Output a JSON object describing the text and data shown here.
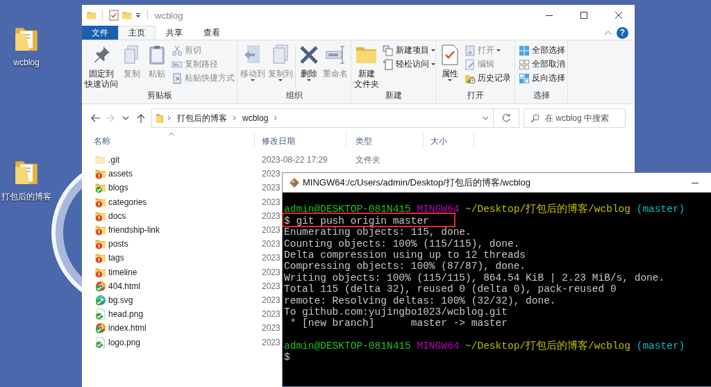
{
  "desktop_icons": [
    {
      "label": "wcblog"
    },
    {
      "label": "打包后的博客"
    }
  ],
  "explorer": {
    "title": "wcblog",
    "ribbon_tabs": [
      {
        "label": "文件",
        "kind": "file",
        "selected": false
      },
      {
        "label": "主页",
        "kind": "tab",
        "selected": true
      },
      {
        "label": "共享",
        "kind": "tab",
        "selected": false
      },
      {
        "label": "查看",
        "kind": "tab",
        "selected": false
      }
    ],
    "help_label": "?",
    "ribbon_groups": [
      {
        "label": "剪贴板",
        "items": [
          {
            "label_lines": [
              "固定到",
              "快速访问"
            ],
            "kind": "large",
            "disabled": false,
            "dropdown": false
          },
          {
            "label": "复制",
            "kind": "large",
            "disabled": true,
            "dropdown": false
          },
          {
            "label": "粘贴",
            "kind": "large",
            "disabled": true,
            "dropdown": false
          },
          {
            "label": "剪切",
            "kind": "small",
            "disabled": true,
            "dropdown": false
          },
          {
            "label": "复制路径",
            "kind": "small",
            "disabled": true,
            "dropdown": false
          },
          {
            "label": "粘贴快捷方式",
            "kind": "small",
            "disabled": true,
            "dropdown": false
          }
        ]
      },
      {
        "label": "组织",
        "items": [
          {
            "label": "移动到",
            "kind": "large",
            "disabled": true,
            "dropdown": true
          },
          {
            "label": "复制到",
            "kind": "large",
            "disabled": true,
            "dropdown": true
          },
          {
            "label": "删除",
            "kind": "large",
            "disabled": false,
            "dropdown": true
          },
          {
            "label": "重命名",
            "kind": "large",
            "disabled": true,
            "dropdown": false
          }
        ]
      },
      {
        "label": "新建",
        "items": [
          {
            "label_lines": [
              "新建",
              "文件夹"
            ],
            "kind": "large",
            "disabled": false,
            "dropdown": false
          },
          {
            "label": "新建项目",
            "kind": "small",
            "disabled": false,
            "dropdown": true
          },
          {
            "label": "轻松访问",
            "kind": "small",
            "disabled": false,
            "dropdown": true
          }
        ]
      },
      {
        "label": "打开",
        "items": [
          {
            "label": "属性",
            "kind": "large",
            "disabled": false,
            "dropdown": true
          },
          {
            "label": "打开",
            "kind": "small",
            "disabled": true,
            "dropdown": true
          },
          {
            "label": "编辑",
            "kind": "small",
            "disabled": true,
            "dropdown": false
          },
          {
            "label": "历史记录",
            "kind": "small",
            "disabled": false,
            "dropdown": false
          }
        ]
      },
      {
        "label": "选择",
        "items": [
          {
            "label": "全部选择",
            "kind": "small",
            "disabled": false,
            "dropdown": false
          },
          {
            "label": "全部取消",
            "kind": "small",
            "disabled": false,
            "dropdown": false
          },
          {
            "label": "反向选择",
            "kind": "small",
            "disabled": false,
            "dropdown": false
          }
        ]
      }
    ],
    "nav_buttons": [
      {
        "kind": "back",
        "disabled": false
      },
      {
        "kind": "forward",
        "disabled": true
      },
      {
        "kind": "recent",
        "disabled": false
      },
      {
        "kind": "up",
        "disabled": false
      }
    ],
    "breadcrumb": [
      "打包后的博客",
      "wcblog"
    ],
    "search": {
      "placeholder": "在 wcblog 中搜索"
    },
    "columns": [
      {
        "label": "名称",
        "sorted": true
      },
      {
        "label": "修改日期",
        "sorted": false
      },
      {
        "label": "类型",
        "sorted": false
      },
      {
        "label": "大小",
        "sorted": false
      }
    ],
    "rows": [
      {
        "name": ".git",
        "kind": "folder",
        "hidden": true,
        "modified": false,
        "date": "2023-08-22 17:29",
        "type": "文件夹"
      },
      {
        "name": "assets",
        "kind": "folder",
        "hidden": false,
        "modified": true,
        "date": "2023"
      },
      {
        "name": "blogs",
        "kind": "folder",
        "hidden": false,
        "modified": false,
        "date": "2023"
      },
      {
        "name": "categories",
        "kind": "folder",
        "hidden": false,
        "modified": true,
        "date": "2023"
      },
      {
        "name": "docs",
        "kind": "folder",
        "hidden": false,
        "modified": true,
        "date": "2023"
      },
      {
        "name": "friendship-link",
        "kind": "folder",
        "hidden": false,
        "modified": true,
        "date": "2023"
      },
      {
        "name": "posts",
        "kind": "folder",
        "hidden": false,
        "modified": true,
        "date": "2023"
      },
      {
        "name": "tags",
        "kind": "folder",
        "hidden": false,
        "modified": true,
        "date": "2023"
      },
      {
        "name": "timeline",
        "kind": "folder",
        "hidden": false,
        "modified": true,
        "date": "2023"
      },
      {
        "name": "404.html",
        "kind": "html",
        "hidden": false,
        "modified": false,
        "date": "2023"
      },
      {
        "name": "bg.svg",
        "kind": "svg",
        "hidden": false,
        "modified": false,
        "date": "2023"
      },
      {
        "name": "head.png",
        "kind": "png",
        "hidden": false,
        "modified": false,
        "date": "2023"
      },
      {
        "name": "index.html",
        "kind": "html",
        "hidden": false,
        "modified": false,
        "date": "2023"
      },
      {
        "name": "logo.png",
        "kind": "png",
        "hidden": false,
        "modified": false,
        "date": "2023"
      }
    ]
  },
  "terminal": {
    "title": "MINGW64:/c/Users/admin/Desktop/打包后的博客/wcblog",
    "lines": [
      {
        "kind": "blank"
      },
      {
        "kind": "prompt",
        "user": "admin@DESKTOP-081N415",
        "host": "MINGW64",
        "path": "~/Desktop/打包后的博客/wcblog",
        "branch": "(master)"
      },
      {
        "kind": "command",
        "text": "$ git push origin master",
        "highlighted": true
      },
      {
        "kind": "output",
        "text": "Enumerating objects: 115, done."
      },
      {
        "kind": "output",
        "text": "Counting objects: 100% (115/115), done."
      },
      {
        "kind": "output",
        "text": "Delta compression using up to 12 threads"
      },
      {
        "kind": "output",
        "text": "Compressing objects: 100% (87/87), done."
      },
      {
        "kind": "output",
        "text": "Writing objects: 100% (115/115), 864.54 KiB | 2.23 MiB/s, done."
      },
      {
        "kind": "output",
        "text": "Total 115 (delta 32), reused 0 (delta 0), pack-reused 0"
      },
      {
        "kind": "output",
        "text": "remote: Resolving deltas: 100% (32/32), done."
      },
      {
        "kind": "output",
        "text": "To github.com:yujingbo1023/wcblog.git"
      },
      {
        "kind": "output",
        "text": " * [new branch]      master -> master"
      },
      {
        "kind": "blank"
      },
      {
        "kind": "prompt",
        "user": "admin@DESKTOP-081N415",
        "host": "MINGW64",
        "path": "~/Desktop/打包后的博客/wcblog",
        "branch": "(master)"
      },
      {
        "kind": "command",
        "text": "$",
        "highlighted": false
      }
    ]
  }
}
